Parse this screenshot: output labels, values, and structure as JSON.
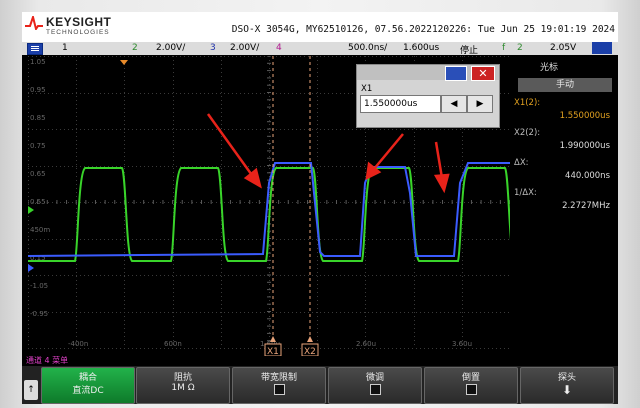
{
  "header": {
    "brand": "KEYSIGHT",
    "brand_sub": "TECHNOLOGIES",
    "model_line": "DSO-X 3054G, MY62510126, 07.56.2022120226: Tue Jun 25 19:01:19 2024"
  },
  "channel_bar": {
    "ch1": "1",
    "ch2_num": "2",
    "ch2_scale": "2.00V/",
    "ch3_num": "3",
    "ch3_scale": "2.00V/",
    "ch4_num": "4",
    "timebase": "500.0ns/",
    "delay": "1.600us",
    "run_state": "停止",
    "trigger_ch": "2",
    "trigger_level": "2.05V"
  },
  "grid": {
    "left_labels": [
      "1.05",
      "0.95",
      "0.85",
      "0.75",
      "0.65",
      "0.55",
      "450m",
      "0.15",
      "-1.05",
      "-0.95"
    ],
    "bottom_labels": [
      "-400n",
      "600n",
      "1.60u",
      "2.60u",
      "3.60u"
    ],
    "cursor_x1": "X1",
    "cursor_x2": "X2",
    "colors": {
      "green": "#39d42a",
      "blue": "#3b5cff",
      "cursor": "#e8a37a",
      "arrow": "#e8231a"
    }
  },
  "popup": {
    "title_label": "X1",
    "value": "1.550000us",
    "left_arrow": "◀",
    "right_arrow": "▶"
  },
  "cursor_panel": {
    "title": "光标",
    "mode": "手动",
    "x1_label": "X1(2):",
    "x1_value": "1.550000us",
    "x2_label": "X2(2):",
    "x2_value": "1.990000us",
    "dx_label": "ΔX:",
    "dx_value": "440.000ns",
    "inv_dx_label": "1/ΔX:",
    "inv_dx_value": "2.2727MHz"
  },
  "softkeys": {
    "menu_title": "通道 4 菜单",
    "coupling_title": "耦合",
    "coupling_value": "直流DC",
    "impedance_title": "阻抗",
    "impedance_value": "1M Ω",
    "bw_limit": "带宽限制",
    "fine": "微调",
    "invert": "倒置",
    "probe": "探头"
  }
}
